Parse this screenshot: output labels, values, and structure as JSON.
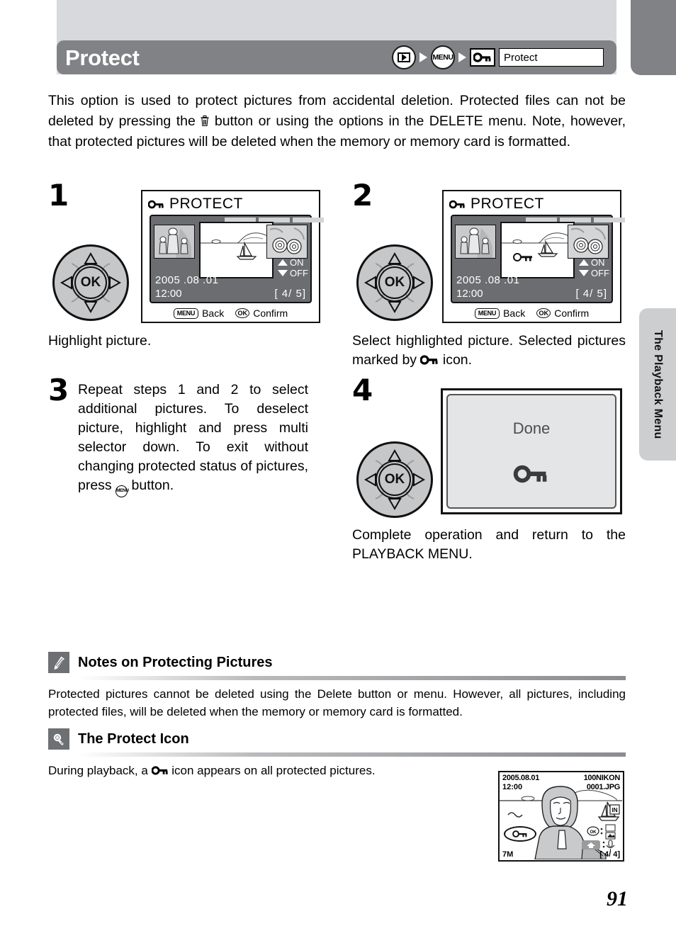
{
  "header": {
    "title": "Protect",
    "breadcrumb": {
      "playback_icon": "playback-icon",
      "menu_label": "MENU",
      "key_icon": "key-icon",
      "field_value": "Protect"
    }
  },
  "side_tab": {
    "label": "The Playback Menu"
  },
  "intro": {
    "part1": "This option is used to protect pictures from accidental deletion. Protected files can not be deleted by pressing the ",
    "trash_icon": "trash-icon",
    "part2": " button or using the options in the DELETE menu. Note, however, that protected pictures will be deleted when the memory or memory card is formatted."
  },
  "steps": {
    "one": {
      "number": "1",
      "caption": "Highlight picture.",
      "multi_selector": {
        "ok_label": "OK"
      }
    },
    "two": {
      "number": "2",
      "caption_part1": "Select highlighted picture. Selected pictures marked by ",
      "caption_icon": "key-icon",
      "caption_part2": " icon.",
      "multi_selector": {
        "ok_label": "OK"
      }
    },
    "three": {
      "number": "3",
      "text_part1": "Repeat steps 1 and 2 to select additional pictures. To deselect picture, highlight and press multi selector down. To exit without changing protected status of pictures, press ",
      "menu_icon": "menu-button-icon",
      "text_part2": " button."
    },
    "four": {
      "number": "4",
      "caption": "Complete operation and return to the PLAYBACK MENU.",
      "multi_selector": {
        "ok_label": "OK"
      },
      "screen": {
        "label": "Done",
        "icon": "key-icon"
      }
    }
  },
  "lcd_screen": {
    "title": "PROTECT",
    "title_icon": "key-icon",
    "on_label": "ON",
    "off_label": "OFF",
    "date": "2005 .08 .01",
    "time": "12:00",
    "counter": "[   4/    5]",
    "footer": {
      "menu_pill": "MENU",
      "back_label": "Back",
      "ok_pill": "OK",
      "confirm_label": "Confirm"
    }
  },
  "notes": [
    {
      "icon": "pencil-icon",
      "title": "Notes on Protecting Pictures",
      "body": "Protected pictures cannot be deleted using the Delete button or menu. However, all pictures, including protected files, will be deleted when the memory or memory card is formatted."
    },
    {
      "icon": "lightbulb-icon",
      "title": "The Protect Icon",
      "body_part1": "During playback, a ",
      "body_icon": "key-icon",
      "body_part2": " icon appears on all protected pictures."
    }
  ],
  "playback_photo": {
    "date": "2005.08.01",
    "time": "12:00",
    "folder": "100NIKON",
    "file": "0001.JPG",
    "image_size": "7M",
    "frame_counter": "[   4/   4]",
    "protect_icon": "key-icon"
  },
  "page_number": "91",
  "colors": {
    "header_bar": "#808285",
    "top_plate": "#d8d9dd",
    "side_tab": "#ccced0",
    "lcd_panel": "#6b6d70"
  }
}
